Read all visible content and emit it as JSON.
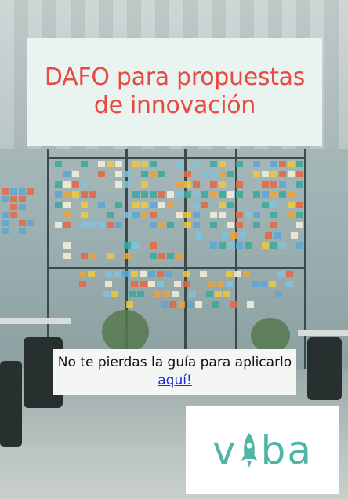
{
  "cover": {
    "title": "DAFO para propuestas de innovación",
    "cta": {
      "text": "No te pierdas la guía para aplicarlo",
      "link_label": "aquí!"
    },
    "logo": {
      "letters_left": "v",
      "letters_right": "ba",
      "icon": "rocket-icon",
      "color": "#4fb5a5"
    }
  },
  "colors": {
    "title": "#e54b43",
    "title_card_bg": "#e9f4f0",
    "link": "#1a2ee0"
  }
}
